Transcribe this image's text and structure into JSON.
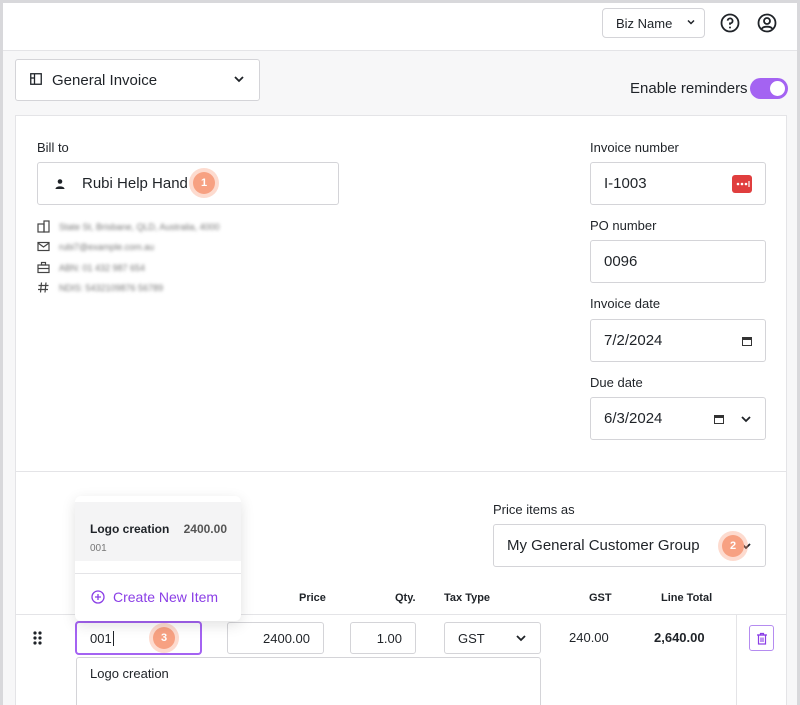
{
  "header": {
    "business_selector": "Biz Name"
  },
  "template": {
    "label": "General Invoice"
  },
  "reminders": {
    "label": "Enable reminders",
    "enabled": true
  },
  "bill_to": {
    "label": "Bill to",
    "customer": "Rubi Help Hand",
    "step_badge": "1",
    "details": {
      "address": "State St, Brisbane, QLD, Australia, 4000",
      "email": "rubi7@example.com.au",
      "abn": "ABN: 01 432 987 654",
      "ndis": "NDIS: 5432109876 56789"
    }
  },
  "invoice_number": {
    "label": "Invoice number",
    "value": "I-1003"
  },
  "po_number": {
    "label": "PO number",
    "value": "0096"
  },
  "invoice_date": {
    "label": "Invoice date",
    "value": "7/2/2024"
  },
  "due_date": {
    "label": "Due date",
    "value": "6/3/2024"
  },
  "price_items": {
    "label": "Price items as",
    "value": "My General Customer Group",
    "step_badge": "2"
  },
  "item_dropdown": {
    "item_name": "Logo creation",
    "item_price": "2400.00",
    "item_code": "001",
    "create_label": "Create New Item"
  },
  "table": {
    "columns": [
      "Price",
      "Qty.",
      "Tax Type",
      "GST",
      "Line Total"
    ],
    "row": {
      "item_code": "001",
      "step_badge": "3",
      "price": "2400.00",
      "qty": "1.00",
      "tax_type": "GST",
      "gst": "240.00",
      "line_total": "2,640.00",
      "description": "Logo creation"
    }
  },
  "colors": {
    "accent": "#a463f2",
    "badge": "#f7a182",
    "invoice_icon": "#e03e3e"
  }
}
